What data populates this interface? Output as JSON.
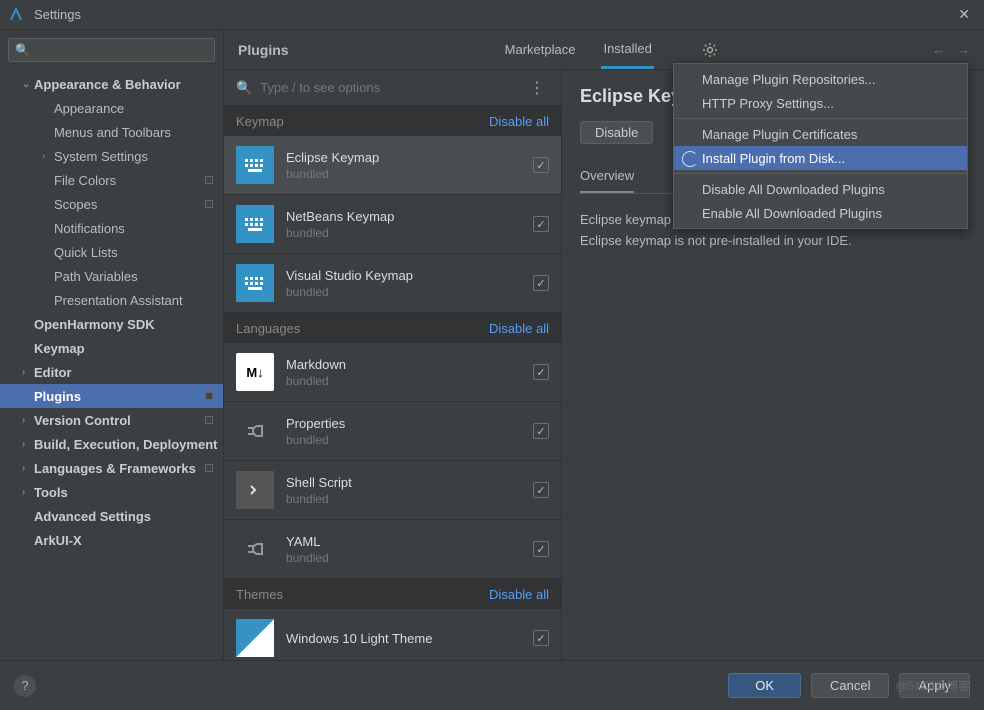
{
  "window": {
    "title": "Settings"
  },
  "sidebar": {
    "search_placeholder": "",
    "items": [
      {
        "label": "Appearance & Behavior",
        "depth": 1,
        "bold": true,
        "expand": true
      },
      {
        "label": "Appearance",
        "depth": 2
      },
      {
        "label": "Menus and Toolbars",
        "depth": 2
      },
      {
        "label": "System Settings",
        "depth": 2,
        "expand": false,
        "chev": true
      },
      {
        "label": "File Colors",
        "depth": 2,
        "badge": true
      },
      {
        "label": "Scopes",
        "depth": 2,
        "badge": true
      },
      {
        "label": "Notifications",
        "depth": 2
      },
      {
        "label": "Quick Lists",
        "depth": 2
      },
      {
        "label": "Path Variables",
        "depth": 2
      },
      {
        "label": "Presentation Assistant",
        "depth": 2
      },
      {
        "label": "OpenHarmony SDK",
        "depth": 1,
        "bold": true
      },
      {
        "label": "Keymap",
        "depth": 1,
        "bold": true
      },
      {
        "label": "Editor",
        "depth": 1,
        "bold": true,
        "chev": true
      },
      {
        "label": "Plugins",
        "depth": 1,
        "bold": true,
        "selected": true,
        "badge": true
      },
      {
        "label": "Version Control",
        "depth": 1,
        "bold": true,
        "chev": true,
        "badge": true
      },
      {
        "label": "Build, Execution, Deployment",
        "depth": 1,
        "bold": true,
        "chev": true
      },
      {
        "label": "Languages & Frameworks",
        "depth": 1,
        "bold": true,
        "chev": true,
        "badge": true
      },
      {
        "label": "Tools",
        "depth": 1,
        "bold": true,
        "chev": true
      },
      {
        "label": "Advanced Settings",
        "depth": 1,
        "bold": true
      },
      {
        "label": "ArkUI-X",
        "depth": 1,
        "bold": true
      }
    ]
  },
  "plugins": {
    "title": "Plugins",
    "tabs": {
      "marketplace": "Marketplace",
      "installed": "Installed"
    },
    "search_placeholder": "Type / to see options",
    "sections": [
      {
        "name": "Keymap",
        "disable_all": "Disable all",
        "items": [
          {
            "name": "Eclipse Keymap",
            "sub": "bundled",
            "icon": "keymap",
            "checked": true,
            "selected": true
          },
          {
            "name": "NetBeans Keymap",
            "sub": "bundled",
            "icon": "keymap",
            "checked": true
          },
          {
            "name": "Visual Studio Keymap",
            "sub": "bundled",
            "icon": "keymap",
            "checked": true
          }
        ]
      },
      {
        "name": "Languages",
        "disable_all": "Disable all",
        "items": [
          {
            "name": "Markdown",
            "sub": "bundled",
            "icon": "md",
            "checked": true
          },
          {
            "name": "Properties",
            "sub": "bundled",
            "icon": "plug",
            "checked": true
          },
          {
            "name": "Shell Script",
            "sub": "bundled",
            "icon": "shell",
            "checked": true
          },
          {
            "name": "YAML",
            "sub": "bundled",
            "icon": "plug",
            "checked": true
          }
        ]
      },
      {
        "name": "Themes",
        "disable_all": "Disable all",
        "items": [
          {
            "name": "Windows 10 Light Theme",
            "sub": "",
            "icon": "theme",
            "checked": true
          }
        ]
      }
    ],
    "details": {
      "title": "Eclipse Keymap",
      "disable": "Disable",
      "tab_overview": "Overview",
      "description": "Eclipse keymap for all IntelliJ-based IDEs. Use this plugin if Eclipse keymap is not pre-installed in your IDE."
    }
  },
  "context_menu": {
    "items": [
      {
        "label": "Manage Plugin Repositories..."
      },
      {
        "label": "HTTP Proxy Settings..."
      },
      {
        "sep": true
      },
      {
        "label": "Manage Plugin Certificates"
      },
      {
        "label": "Install Plugin from Disk...",
        "selected": true
      },
      {
        "sep": true
      },
      {
        "label": "Disable All Downloaded Plugins"
      },
      {
        "label": "Enable All Downloaded Plugins"
      }
    ]
  },
  "footer": {
    "ok": "OK",
    "cancel": "Cancel",
    "apply": "Apply",
    "help": "?"
  },
  "watermark": "@51CTO博客"
}
